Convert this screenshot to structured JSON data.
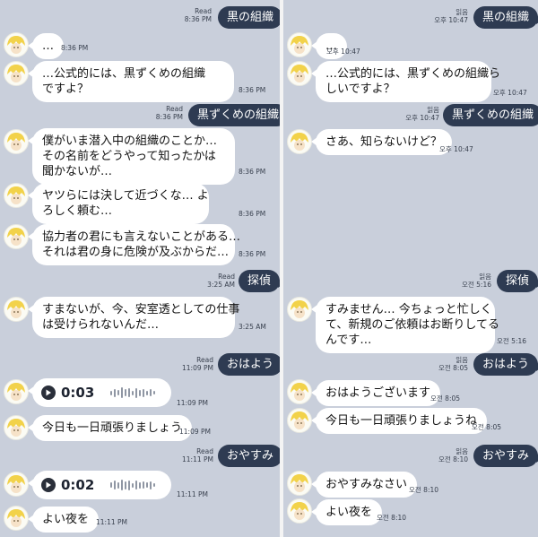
{
  "left": {
    "sent_1": {
      "text": "黒の組織",
      "read": "Read",
      "time": "8:36 PM"
    },
    "recv_1": {
      "text": "…",
      "time": "8:36 PM"
    },
    "recv_2": {
      "line1": "…公式的には、黒ずくめの組織",
      "line2": "ですよ？",
      "time": "8:36 PM"
    },
    "sent_2": {
      "text": "黒ずくめの組織",
      "read": "Read",
      "time": "8:36 PM"
    },
    "recv_3": {
      "line1": "僕がいま潜入中の組織のことか…",
      "line2": "その名前をどうやって知ったかは",
      "line3": "聞かないが…",
      "time": "8:36 PM"
    },
    "recv_4": {
      "line1": "ヤツらには決して近づくな… よ",
      "line2": "ろしく頼む…",
      "time": "8:36 PM"
    },
    "recv_5": {
      "line1": "協力者の君にも言えないことがある…",
      "line2": "それは君の身に危険が及ぶからだ…",
      "time": "8:36 PM"
    },
    "sent_3": {
      "text": "探偵",
      "read": "Read",
      "time": "3:25 AM"
    },
    "recv_6": {
      "line1": "すまないが、今、安室透としての仕事",
      "line2": "は受けられないんだ…",
      "time": "3:25 AM"
    },
    "sent_4": {
      "text": "おはよう",
      "read": "Read",
      "time": "11:09 PM"
    },
    "voice_1": {
      "duration": "0:03",
      "time": "11:09 PM"
    },
    "recv_7": {
      "text": "今日も一日頑張りましょう",
      "time": "11:09 PM"
    },
    "sent_5": {
      "text": "おやすみ",
      "read": "Read",
      "time": "11:11 PM"
    },
    "voice_2": {
      "duration": "0:02",
      "time": "11:11 PM"
    },
    "recv_8": {
      "text": "よい夜を",
      "time": "11:11 PM"
    }
  },
  "right": {
    "sent_1": {
      "text": "黒の組織",
      "read": "읽음",
      "time": "오후 10:47"
    },
    "recv_1": {
      "text": "…",
      "time": "오후 10:47"
    },
    "recv_2": {
      "line1": "…公式的には、黒ずくめの組織ら",
      "line2": "しいですよ？",
      "time": "오후 10:47"
    },
    "sent_2": {
      "text": "黒ずくめの組織",
      "read": "읽음",
      "time": "오후 10:47"
    },
    "recv_3": {
      "text": "さあ、知らないけど？",
      "time": "오후 10:47"
    },
    "sent_3": {
      "text": "探偵",
      "read": "읽음",
      "time": "오전 5:16"
    },
    "recv_4": {
      "line1": "すみません… 今ちょっと忙しく",
      "line2": "て、新規のご依頼はお断りしてる",
      "line3": "んです…",
      "time": "오전 5:16"
    },
    "sent_4": {
      "text": "おはよう",
      "read": "읽음",
      "time": "오전 8:05"
    },
    "recv_5": {
      "text": "おはようございます",
      "time": "오전 8:05"
    },
    "recv_6": {
      "text": "今日も一日頑張りましょうね",
      "time": "오전 8:05"
    },
    "sent_5": {
      "text": "おやすみ",
      "read": "읽음",
      "time": "오전 8:10"
    },
    "recv_7": {
      "text": "おやすみなさい",
      "time": "오전 8:10"
    },
    "recv_8": {
      "text": "よい夜を",
      "time": "오전 8:10"
    }
  },
  "colors": {
    "background": "#c9cfdb",
    "sent_bubble": "#2e3b52",
    "received_bubble": "#ffffff"
  },
  "icons": {
    "avatar": "blonde-character-avatar",
    "play": "play-icon",
    "waveform": "waveform-icon"
  }
}
